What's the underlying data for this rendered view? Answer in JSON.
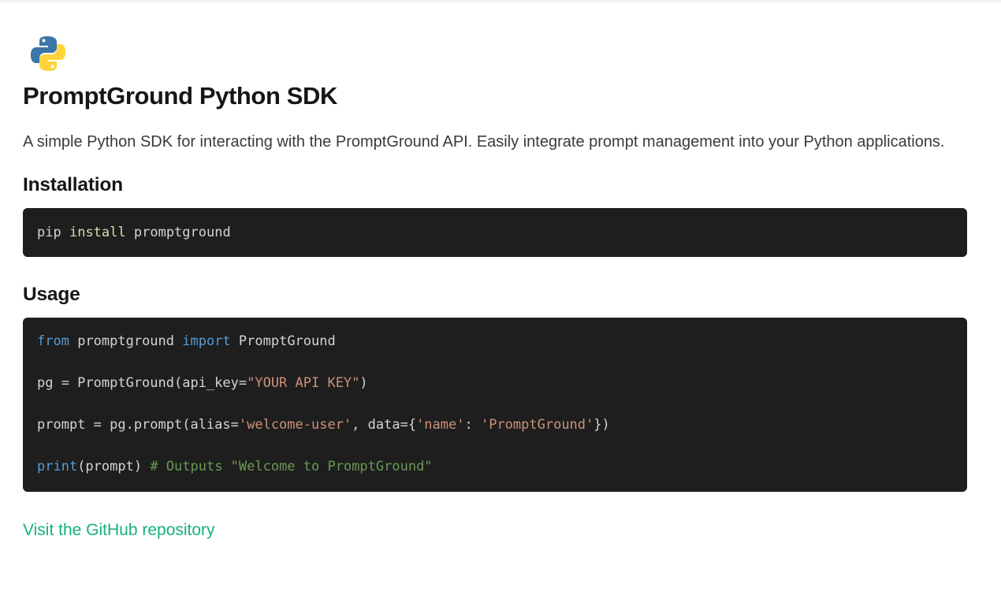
{
  "logo": {
    "icon": "python-logo-icon",
    "colors": {
      "blue": "#3b77a8",
      "yellow": "#ffd43b"
    }
  },
  "title": "PromptGround Python SDK",
  "description": "A simple Python SDK for interacting with the PromptGround API. Easily integrate prompt management into your Python applications.",
  "installation": {
    "heading": "Installation",
    "code": {
      "cmd": "pip",
      "sub": "install",
      "pkg": "promptground"
    }
  },
  "usage": {
    "heading": "Usage",
    "line1": {
      "kw1": "from",
      "mod": " promptground ",
      "kw2": "import",
      "cls": " PromptGround"
    },
    "line2": {
      "pre": "pg = PromptGround(api_key=",
      "str": "\"YOUR API KEY\"",
      "post": ")"
    },
    "line3": {
      "pre": "prompt = pg.prompt(alias=",
      "str1": "'welcome-user'",
      "mid": ", data={",
      "str2": "'name'",
      "colon": ": ",
      "str3": "'PromptGround'",
      "post": "})"
    },
    "line4": {
      "fn": "print",
      "args": "(prompt) ",
      "comment": "# Outputs \"Welcome to PromptGround\""
    }
  },
  "link": {
    "label": "Visit the GitHub repository"
  },
  "colors": {
    "code_bg": "#1e1e1e",
    "keyword": "#569cd6",
    "string": "#ce9178",
    "comment": "#6a9955",
    "function": "#dcdcaa",
    "link": "#16b07b"
  }
}
